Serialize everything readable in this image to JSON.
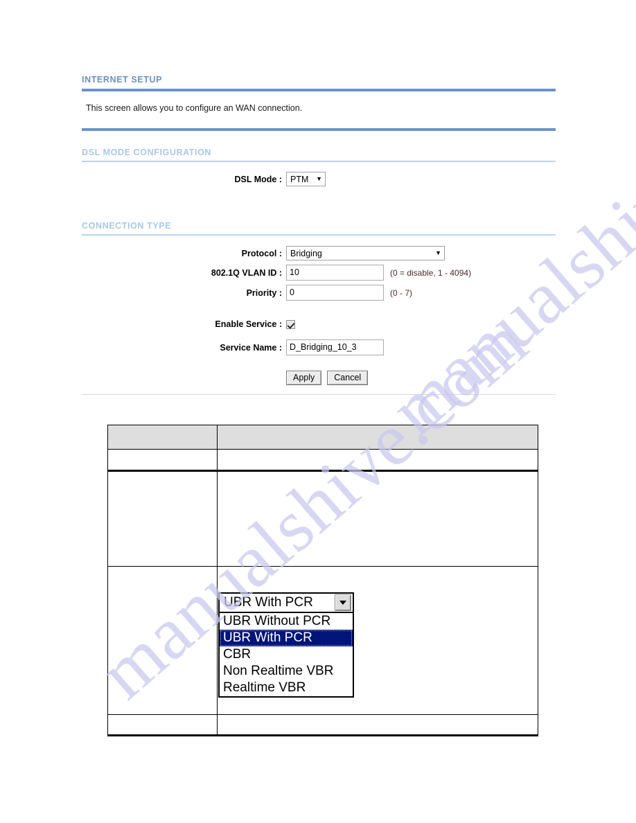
{
  "sections": {
    "internet_setup": {
      "title": "INTERNET SETUP",
      "description": "This screen allows you to configure an WAN connection."
    },
    "dsl_mode": {
      "title": "DSL MODE CONFIGURATION",
      "dsl_mode_label": "DSL Mode :",
      "dsl_mode_value": "PTM"
    },
    "connection_type": {
      "title": "CONNECTION TYPE",
      "protocol_label": "Protocol :",
      "protocol_value": "Bridging",
      "vlan_label": "802.1Q VLAN ID :",
      "vlan_value": "10",
      "vlan_hint": "(0 = disable, 1 - 4094)",
      "priority_label": "Priority :",
      "priority_value": "0",
      "priority_hint": "(0 - 7)",
      "enable_service_label": "Enable Service :",
      "enable_service_checked": true,
      "service_name_label": "Service Name :",
      "service_name_value": "D_Bridging_10_3",
      "apply_label": "Apply",
      "cancel_label": "Cancel"
    }
  },
  "reference_table": {
    "header": [
      "",
      ""
    ],
    "rows": [
      [
        "",
        ""
      ],
      [
        "",
        ""
      ],
      [
        "",
        ""
      ],
      [
        "",
        ""
      ]
    ]
  },
  "qos_dropdown": {
    "selected_value": "UBR With PCR",
    "options": [
      "UBR Without PCR",
      "UBR With PCR",
      "CBR",
      "Non Realtime VBR",
      "Realtime VBR"
    ],
    "selected_index": 1
  },
  "watermark": {
    "text": "manualshive.com"
  },
  "colors": {
    "header_dark": "#6d8fbe",
    "header_light": "#a9c8e8",
    "rule_thick": "#6a93c8",
    "rule_thin": "#b9d4ee",
    "table_header_bg": "#dedede",
    "dropdown_selected_bg": "#00147a"
  }
}
